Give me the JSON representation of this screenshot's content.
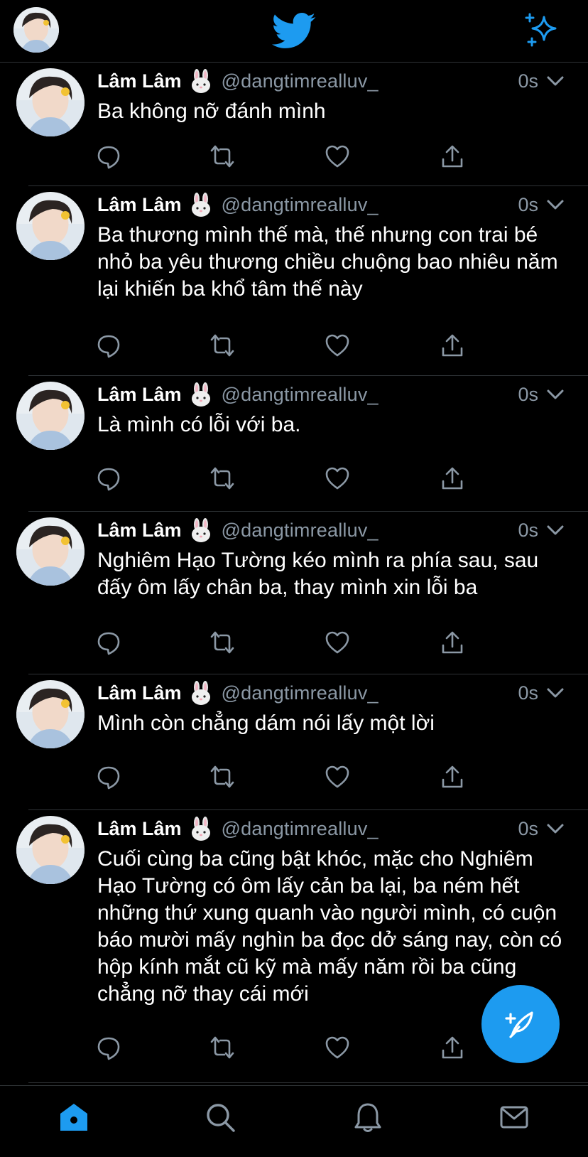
{
  "app": {
    "accent": "#1d9bf0",
    "icons": {
      "logo": "twitter-bird-icon",
      "top_right": "sparkle-icon"
    }
  },
  "tweets": [
    {
      "name": "Lâm Lâm",
      "emoji": "rabbit-face",
      "handle": "@dangtimrealluv_",
      "time": "0s",
      "text": "Ba không nỡ đánh mình"
    },
    {
      "name": "Lâm Lâm",
      "emoji": "rabbit-face",
      "handle": "@dangtimrealluv_",
      "time": "0s",
      "text": "Ba thương mình thế mà, thế nhưng con trai bé nhỏ ba yêu thương chiều chuộng bao nhiêu năm lại khiến ba khổ tâm thế này"
    },
    {
      "name": "Lâm Lâm",
      "emoji": "rabbit-face",
      "handle": "@dangtimrealluv_",
      "time": "0s",
      "text": "Là mình có lỗi với ba."
    },
    {
      "name": "Lâm Lâm",
      "emoji": "rabbit-face",
      "handle": "@dangtimrealluv_",
      "time": "0s",
      "text": "Nghiêm Hạo Tường kéo mình ra phía sau, sau đấy ôm lấy chân ba, thay mình xin lỗi ba"
    },
    {
      "name": "Lâm Lâm",
      "emoji": "rabbit-face",
      "handle": "@dangtimrealluv_",
      "time": "0s",
      "text": "Mình còn chẳng dám nói lấy một lời"
    },
    {
      "name": "Lâm Lâm",
      "emoji": "rabbit-face",
      "handle": "@dangtimrealluv_",
      "time": "0s",
      "text": "Cuối cùng ba cũng bật khóc, mặc cho Nghiêm Hạo Tường có ôm lấy cản ba lại, ba ném hết những thứ xung quanh vào người mình, có cuộn báo mười mấy nghìn ba đọc dở sáng nay, còn có hộp kính mắt cũ kỹ mà mấy năm rồi ba cũng chẳng nỡ thay cái mới"
    }
  ],
  "tabbar": {
    "items": [
      "home-icon",
      "search-icon",
      "notifications-icon",
      "messages-icon"
    ],
    "active": "home-icon"
  },
  "fab": {
    "icon": "compose-tweet-icon"
  }
}
